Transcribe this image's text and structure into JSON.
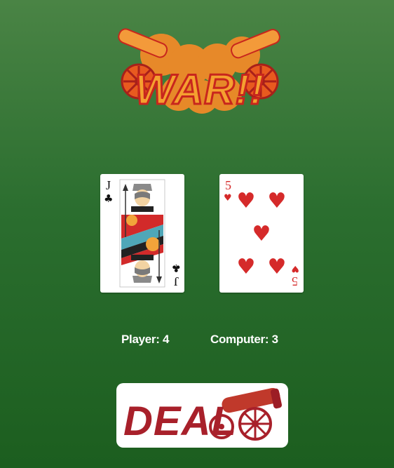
{
  "logo": {
    "text": "WAR!!"
  },
  "player_card": {
    "rank": "J",
    "suit": "clubs",
    "suit_symbol": "♣",
    "color": "#111111"
  },
  "computer_card": {
    "rank": "5",
    "suit": "hearts",
    "suit_symbol": "♥",
    "color": "#d52a2a"
  },
  "scores": {
    "player_label": "Player: 4",
    "computer_label": "Computer: 3"
  },
  "deal_button": {
    "label": "DEAL"
  },
  "colors": {
    "background_top": "#4a8445",
    "background_bottom": "#1c5e1f",
    "logo_orange": "#f08a28",
    "logo_red": "#c8261d",
    "deal_red": "#a8202a"
  }
}
